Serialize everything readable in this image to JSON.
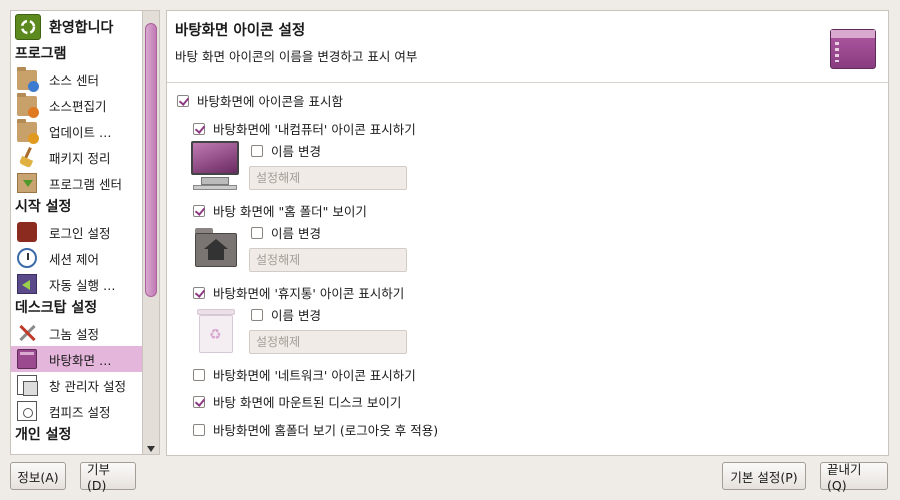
{
  "sidebar": {
    "welcome": "환영합니다",
    "groups": [
      {
        "title": "프로그램",
        "items": [
          "소스 센터",
          "소스편집기",
          "업데이트 …",
          "패키지 정리",
          "프로그램 센터"
        ]
      },
      {
        "title": "시작 설정",
        "items": [
          "로그인 설정",
          "세션 제어",
          "자동 실행 …"
        ]
      },
      {
        "title": "데스크탑 설정",
        "items": [
          "그놈 설정",
          "바탕화면 …",
          "창 관리자 설정",
          "컴피즈 설정"
        ]
      },
      {
        "title": "개인 설정",
        "items": []
      }
    ],
    "selected_item": "바탕화면 …"
  },
  "main": {
    "title": "바탕화면 아이콘 설정",
    "subtitle": "바탕 화면 아이콘의 이름을 변경하고 표시 여부",
    "show_icons": {
      "label": "바탕화면에 아이콘을 표시함",
      "checked": true
    },
    "computer": {
      "label": "바탕화면에 '내컴퓨터' 아이콘 표시하기",
      "checked": true,
      "rename_label": "이름 변경",
      "rename_checked": false,
      "placeholder": "설정해제"
    },
    "home": {
      "label": "바탕 화면에 \"홈 폴더\" 보이기",
      "checked": true,
      "rename_label": "이름 변경",
      "rename_checked": false,
      "placeholder": "설정해제"
    },
    "trash": {
      "label": "바탕화면에 '휴지통' 아이콘 표시하기",
      "checked": true,
      "rename_label": "이름 변경",
      "rename_checked": false,
      "placeholder": "설정해제"
    },
    "network": {
      "label": "바탕화면에 '네트워크' 아이콘 표시하기",
      "checked": false
    },
    "mounted": {
      "label": "바탕 화면에 마운트된 디스크 보이기",
      "checked": true
    },
    "home_as_desktop": {
      "label": "바탕화면에 홈폴더 보기 (로그아웃 후 적용)",
      "checked": false
    }
  },
  "buttons": {
    "about": "정보(A)",
    "donate": "기부(D)",
    "defaults": "기본 설정(P)",
    "quit": "끝내기(Q)"
  },
  "colors": {
    "accent": "#8c3a82",
    "selection": "#e4b6dc"
  }
}
